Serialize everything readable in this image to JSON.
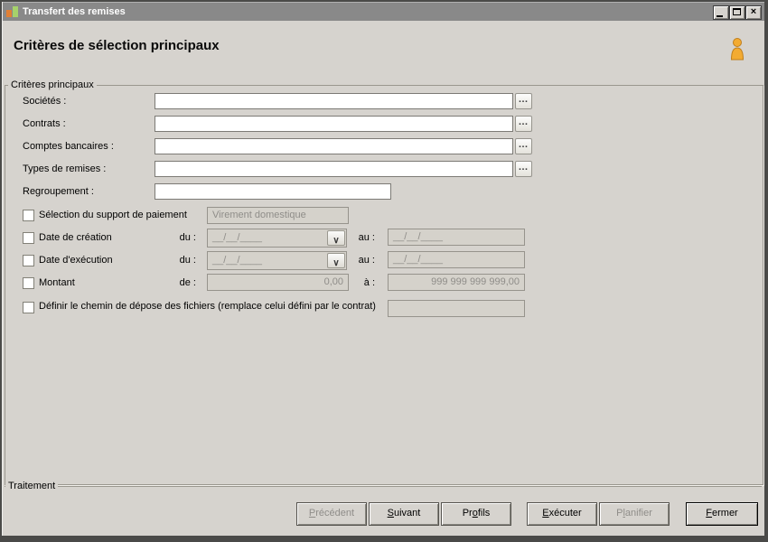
{
  "colors": {
    "titlebar": "#898989",
    "dialog_bg": "#d6d3ce",
    "frame": "#4a4a48",
    "disabled_text": "#8f8d89",
    "person_icon_fill": "#f3ab32",
    "person_icon_outline": "#c07f1c",
    "app_icon_green": "#a6d16b",
    "app_icon_orange": "#e07f35"
  },
  "titlebar": {
    "title": "Transfert des remises"
  },
  "icons": {
    "browse": "…",
    "dropdown": "∨",
    "close": "×"
  },
  "header": {
    "title": "Critères de sélection principaux"
  },
  "main_group": {
    "label": "Critères principaux",
    "lookup_fields": [
      {
        "label": "Sociétés :",
        "value": ""
      },
      {
        "label": "Contrats :",
        "value": ""
      },
      {
        "label": "Comptes bancaires :",
        "value": ""
      },
      {
        "label": "Types de remises :",
        "value": ""
      }
    ],
    "regroupement": {
      "label": "Regroupement :",
      "value": ""
    },
    "payment": {
      "label": "Sélection du support de paiement",
      "value": "Virement domestique",
      "checked": false
    },
    "date_creation": {
      "label": "Date de création",
      "from_label": "du :",
      "to_label": "au :",
      "from_value": "__/__/____",
      "to_value": "__/__/____",
      "checked": false
    },
    "date_execution": {
      "label": "Date d'exécution",
      "from_label": "du :",
      "to_label": "au :",
      "from_value": "__/__/____",
      "to_value": "__/__/____",
      "checked": false
    },
    "montant": {
      "label": "Montant",
      "from_label": "de :",
      "to_label": "à :",
      "from_value": "0,00",
      "to_value": "999 999 999 999,00",
      "checked": false
    },
    "chemin": {
      "label": "Définir le chemin de dépose des fichiers (remplace celui défini par le contrat)",
      "value": "",
      "checked": false
    }
  },
  "bottom_group": {
    "label": "Traitement"
  },
  "buttons": [
    {
      "pre": "",
      "key": "P",
      "post": "récédent",
      "state": "disabled"
    },
    {
      "pre": "",
      "key": "S",
      "post": "uivant",
      "state": "enabled"
    },
    {
      "pre": "Pr",
      "key": "o",
      "post": "fils",
      "state": "enabled"
    },
    {
      "pre": "",
      "key": "E",
      "post": "xécuter",
      "state": "enabled"
    },
    {
      "pre": "P",
      "key": "l",
      "post": "anifier",
      "state": "disabled"
    },
    {
      "pre": "",
      "key": "F",
      "post": "ermer",
      "state": "default"
    }
  ]
}
